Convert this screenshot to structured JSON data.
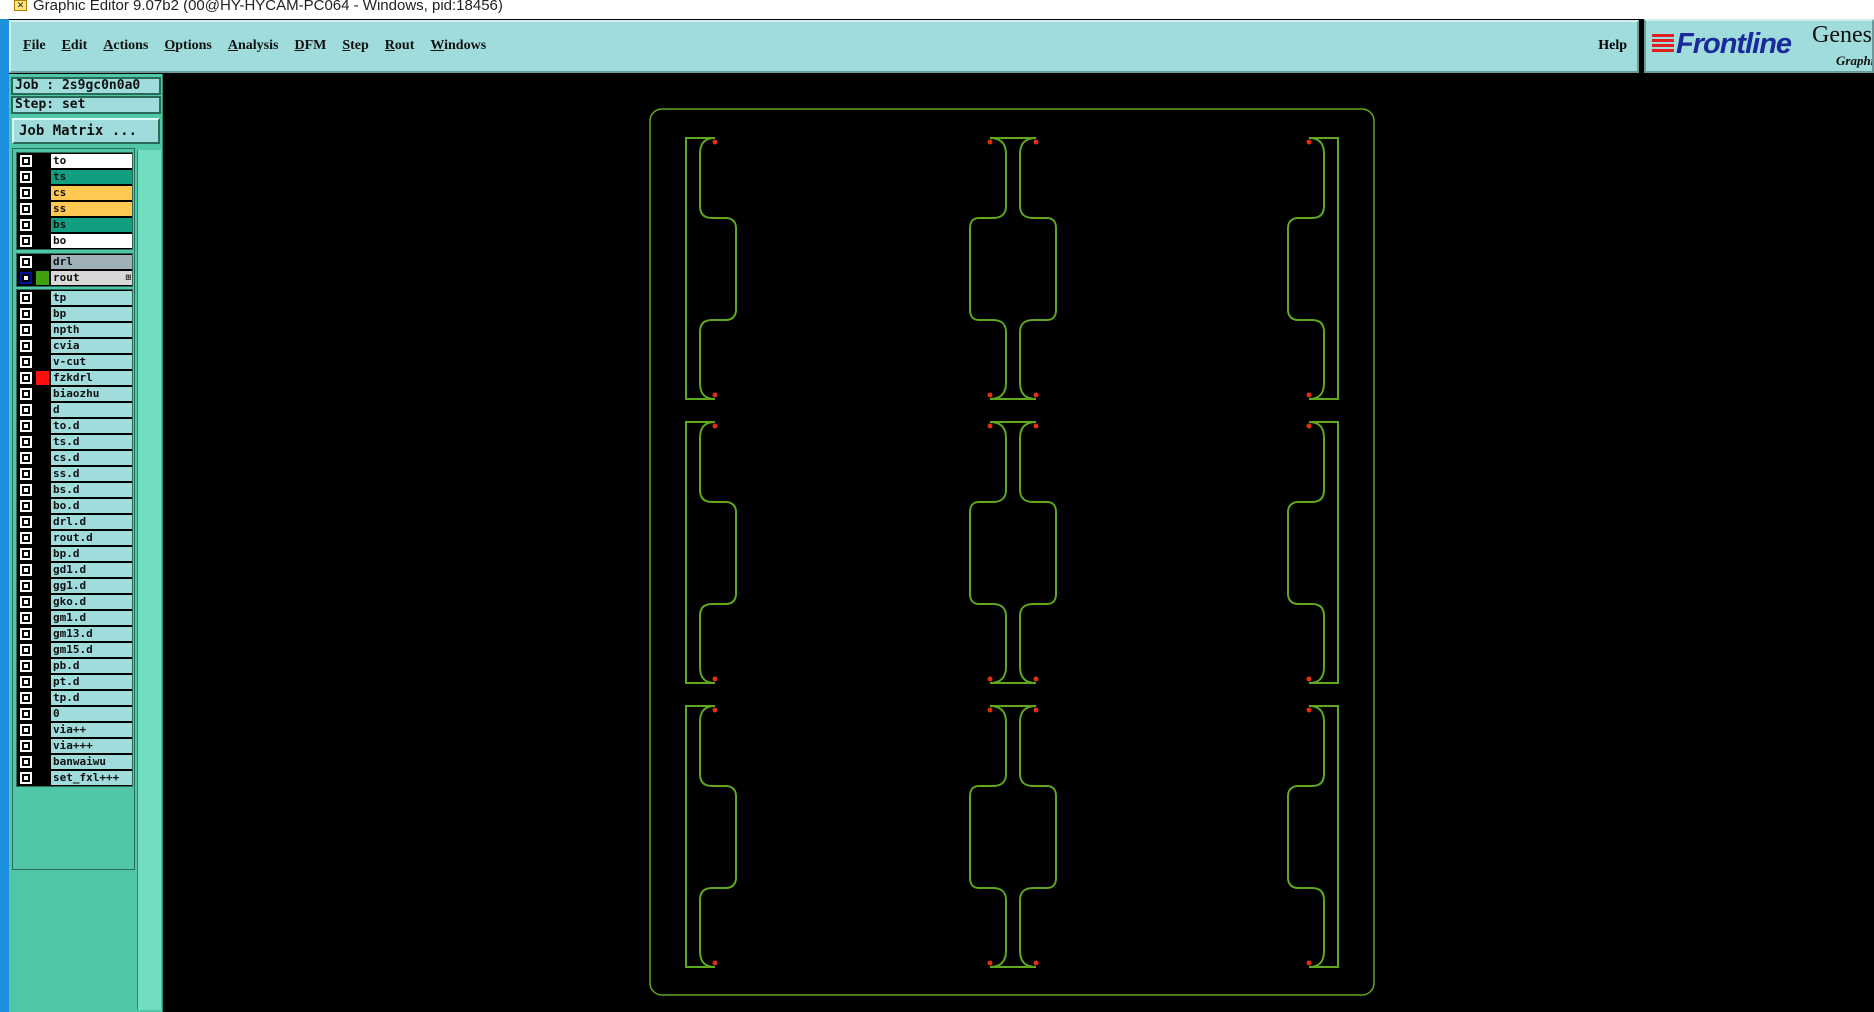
{
  "window": {
    "title": "Graphic Editor 9.07b2 (00@HY-HYCAM-PC064 - Windows, pid:18456)"
  },
  "menubar": {
    "items": [
      "File",
      "Edit",
      "Actions",
      "Options",
      "Analysis",
      "DFM",
      "Step",
      "Rout",
      "Windows"
    ],
    "help": "Help"
  },
  "logo": {
    "brand": "Frontline",
    "product": "Genesis",
    "subtitle": "Graphic"
  },
  "job": {
    "job_label": "Job : 2s9gc0n0a0",
    "step_label": "Step: set",
    "matrix_button": "Job Matrix ..."
  },
  "layers": {
    "board": [
      {
        "name": "to",
        "bg": "#ffffff"
      },
      {
        "name": "ts",
        "bg": "#10a080"
      },
      {
        "name": "cs",
        "bg": "#ffc850"
      },
      {
        "name": "ss",
        "bg": "#ffc850"
      },
      {
        "name": "bs",
        "bg": "#10a080"
      },
      {
        "name": "bo",
        "bg": "#ffffff"
      }
    ],
    "drill": [
      {
        "name": "drl",
        "bg": "#a0b0b8"
      },
      {
        "name": "rout",
        "bg": "#d8d8d8",
        "swatch": "#40a010",
        "selected": true,
        "plus_icon": true
      }
    ],
    "misc": [
      {
        "name": "tp"
      },
      {
        "name": "bp"
      },
      {
        "name": "npth"
      },
      {
        "name": "cvia"
      },
      {
        "name": "v-cut"
      },
      {
        "name": "fzkdrl",
        "swatch": "#ff1010"
      },
      {
        "name": "biaozhu"
      },
      {
        "name": "d"
      },
      {
        "name": "to.d"
      },
      {
        "name": "ts.d"
      },
      {
        "name": "cs.d"
      },
      {
        "name": "ss.d"
      },
      {
        "name": "bs.d"
      },
      {
        "name": "bo.d"
      },
      {
        "name": "drl.d"
      },
      {
        "name": "rout.d"
      },
      {
        "name": "bp.d"
      },
      {
        "name": "gd1.d"
      },
      {
        "name": "gg1.d"
      },
      {
        "name": "gko.d"
      },
      {
        "name": "gm1.d"
      },
      {
        "name": "gm13.d"
      },
      {
        "name": "gm15.d"
      },
      {
        "name": "pb.d"
      },
      {
        "name": "pt.d"
      },
      {
        "name": "tp.d"
      },
      {
        "name": "0"
      },
      {
        "name": "via++"
      },
      {
        "name": "via+++"
      },
      {
        "name": "banwaiwu"
      },
      {
        "name": "set_fxl+++"
      }
    ],
    "misc_bg": "#a0dcdc"
  },
  "colors": {
    "rout_line": "#5fa820",
    "endpoint": "#e03010",
    "canvas": "#000000"
  },
  "canvas": {
    "grid_rows": 3,
    "grid_cols": 3
  }
}
